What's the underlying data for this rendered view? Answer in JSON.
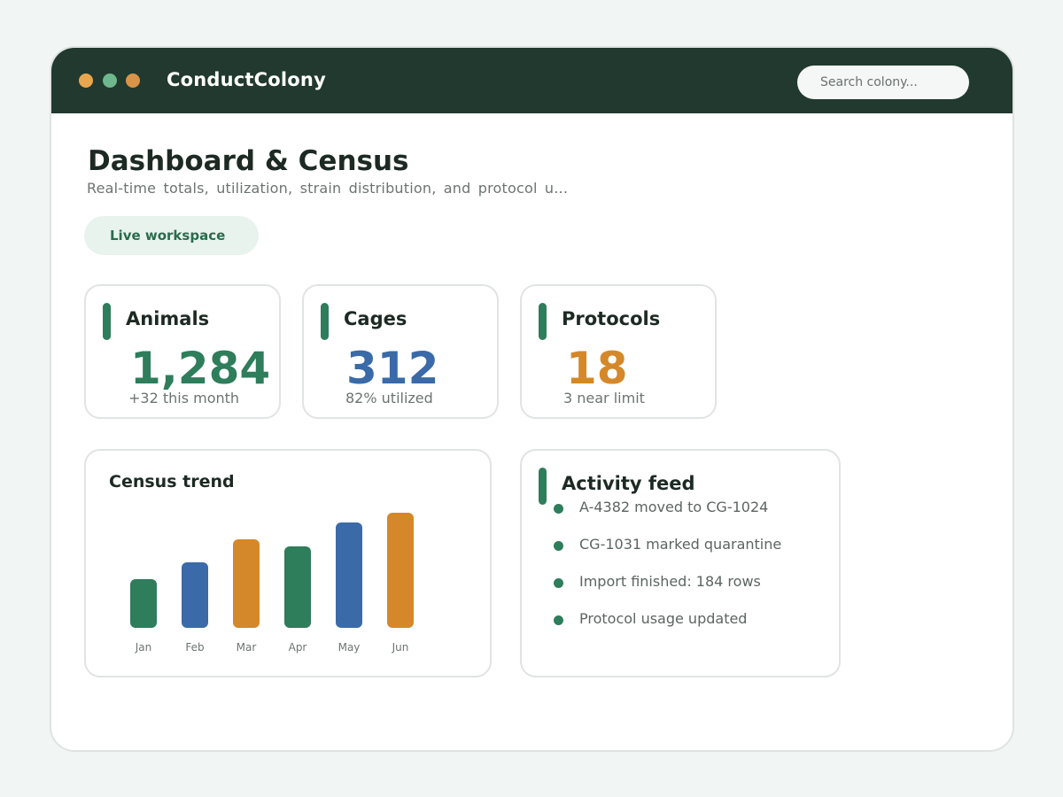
{
  "app": {
    "title": "ConductColony",
    "search_placeholder": "Search colony..."
  },
  "page": {
    "title": "Dashboard & Census",
    "subtitle": "Real-time totals, utilization, strain distribution, and protocol u...",
    "pill_label": "Live workspace"
  },
  "stats": [
    {
      "label": "Animals",
      "value": "1,284",
      "note": "+32 this month",
      "color": "#2e7d5b"
    },
    {
      "label": "Cages",
      "value": "312",
      "note": "82% utilized",
      "color": "#3a6aa8"
    },
    {
      "label": "Protocols",
      "value": "18",
      "note": "3 near limit",
      "color": "#d4882a"
    }
  ],
  "census": {
    "title": "Census trend"
  },
  "chart_data": {
    "type": "bar",
    "title": "Census trend",
    "categories": [
      "Jan",
      "Feb",
      "Mar",
      "Apr",
      "May",
      "Jun"
    ],
    "values": [
      55,
      74,
      100,
      92,
      119,
      130
    ],
    "colors": [
      "#2e7d5b",
      "#3a6aa8",
      "#d4882a",
      "#2e7d5b",
      "#3a6aa8",
      "#d4882a"
    ],
    "grid": false,
    "ylim": [
      0,
      130
    ]
  },
  "feed": {
    "title": "Activity feed",
    "items": [
      "A-4382 moved to CG-1024",
      "CG-1031 marked quarantine",
      "Import finished: 184 rows",
      "Protocol usage updated"
    ]
  },
  "colors": {
    "header_bg": "#21392f",
    "accent_green": "#2e7d5b",
    "accent_blue": "#3a6aa8",
    "accent_orange": "#d4882a"
  }
}
